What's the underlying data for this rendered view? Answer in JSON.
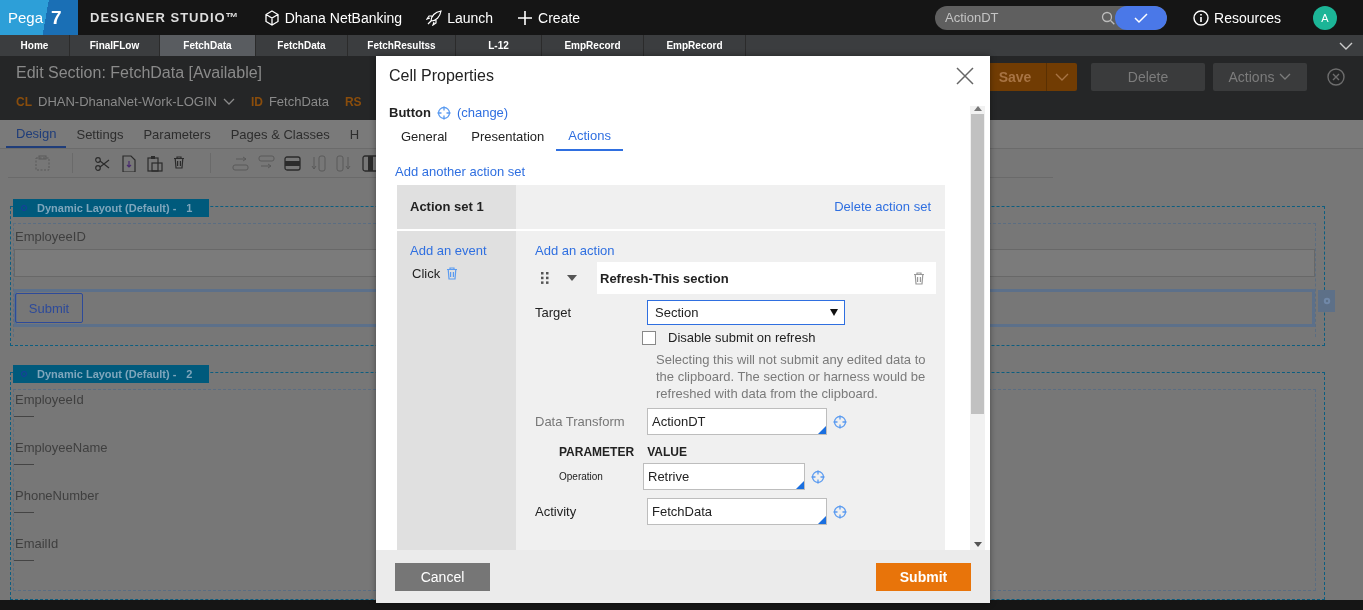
{
  "header": {
    "brand": "Pega",
    "version": "7",
    "studio": "DESIGNER STUDIO™",
    "menu": [
      {
        "kind": "app",
        "label": "Dhana NetBanking"
      },
      {
        "kind": "launch",
        "label": "Launch"
      },
      {
        "kind": "create",
        "label": "Create"
      }
    ],
    "search": {
      "value": "ActionDT"
    },
    "resources": "Resources",
    "avatar": "A"
  },
  "rule_tabs": [
    {
      "label": "Home",
      "selected": false
    },
    {
      "label": "FinalFLow",
      "selected": false
    },
    {
      "label": "FetchData",
      "selected": true
    },
    {
      "label": "FetchData",
      "selected": false
    },
    {
      "label": "FetchResultss",
      "selected": false
    },
    {
      "label": "L-12",
      "selected": false
    },
    {
      "label": "EmpRecord",
      "selected": false
    },
    {
      "label": "EmpRecord",
      "selected": false
    }
  ],
  "editor": {
    "title": "Edit Section: FetchData [Available]",
    "class_label": "CL",
    "class_value": "DHAN-DhanaNet-Work-LOGIN",
    "id_label": "ID",
    "id_value": "FetchData",
    "rs_label": "RS",
    "buttons": {
      "save": "Save",
      "delete": "Delete",
      "actions": "Actions"
    },
    "tabs": [
      {
        "label": "Design",
        "selected": true
      },
      {
        "label": "Settings",
        "selected": false
      },
      {
        "label": "Parameters",
        "selected": false
      },
      {
        "label": "Pages & Classes",
        "selected": false
      },
      {
        "label": "H",
        "selected": false
      }
    ],
    "layouts": [
      {
        "title": "Dynamic Layout (Default) -",
        "number": "1",
        "fields": [
          {
            "kind": "input",
            "label": "EmployeeID"
          },
          {
            "kind": "button",
            "label": "Submit"
          }
        ]
      },
      {
        "title": "Dynamic Layout (Default) -",
        "number": "2",
        "fields": [
          {
            "kind": "display",
            "label": "EmployeeId",
            "value": "——"
          },
          {
            "kind": "display",
            "label": "EmployeeName",
            "value": "——"
          },
          {
            "kind": "display",
            "label": "PhoneNumber",
            "value": "——"
          },
          {
            "kind": "display",
            "label": "EmailId",
            "value": "——"
          }
        ]
      }
    ]
  },
  "dialog": {
    "title": "Cell Properties",
    "control": "Button",
    "change": "(change)",
    "tabs": [
      {
        "label": "General",
        "selected": false
      },
      {
        "label": "Presentation",
        "selected": false
      },
      {
        "label": "Actions",
        "selected": true
      }
    ],
    "add_action_set": "Add another action set",
    "action_set": {
      "title": "Action set 1",
      "delete": "Delete action set",
      "add_event": "Add an event",
      "events": [
        {
          "label": "Click"
        }
      ],
      "add_action": "Add an action",
      "action": {
        "title": "Refresh-This section",
        "target_label": "Target",
        "target_value": "Section",
        "disable_submit": {
          "label": "Disable submit on refresh",
          "checked": false
        },
        "help": "Selecting this will not submit any edited data to the clipboard. The section or harness would be refreshed with data from the clipboard.",
        "data_transform_label": "Data Transform",
        "data_transform": "ActionDT",
        "param_header": "PARAMETER",
        "value_header": "VALUE",
        "params": [
          {
            "name": "Operation",
            "value": "Retrive"
          }
        ],
        "activity_label": "Activity",
        "activity": "FetchData"
      }
    },
    "buttons": {
      "cancel": "Cancel",
      "submit": "Submit"
    }
  }
}
